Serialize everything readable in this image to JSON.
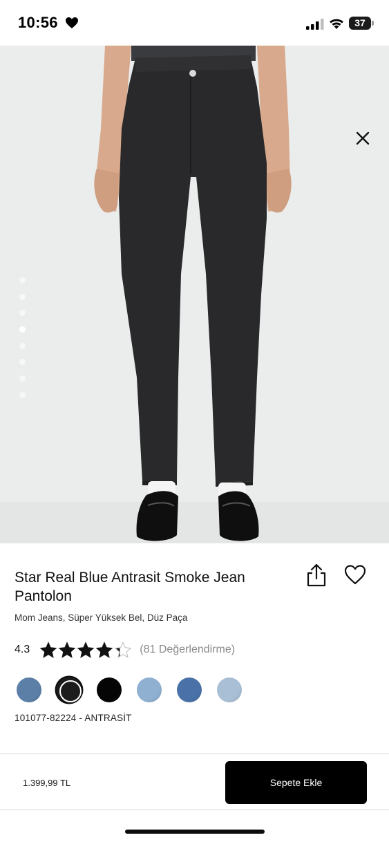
{
  "status_bar": {
    "time": "10:56",
    "battery": "37",
    "icons": [
      "heart-icon",
      "signal-icon",
      "wifi-icon",
      "battery-icon"
    ]
  },
  "gallery": {
    "image_description": "product photo: black high-waist mom jeans",
    "dot_count": 8,
    "active_index": 3
  },
  "product": {
    "title": "Star Real Blue Antrasit Smoke Jean Pantolon",
    "subtitle": "Mom Jeans, Süper Yüksek Bel, Düz Paça",
    "rating": "4.3",
    "rating_stars": 4.3,
    "review_count": "(81 Değerlendirme)",
    "sku": "101077-82224 - ANTRASİT",
    "swatches": [
      {
        "color": "#5b7fa6"
      },
      {
        "color": "#1c1c1d",
        "selected": true
      },
      {
        "color": "#050506"
      },
      {
        "color": "#8fb0d1"
      },
      {
        "color": "#4a72a8"
      },
      {
        "color": "#a9bfd6"
      }
    ]
  },
  "bottom_bar": {
    "price": "1.399,99 TL",
    "add_to_cart": "Sepete Ekle"
  }
}
